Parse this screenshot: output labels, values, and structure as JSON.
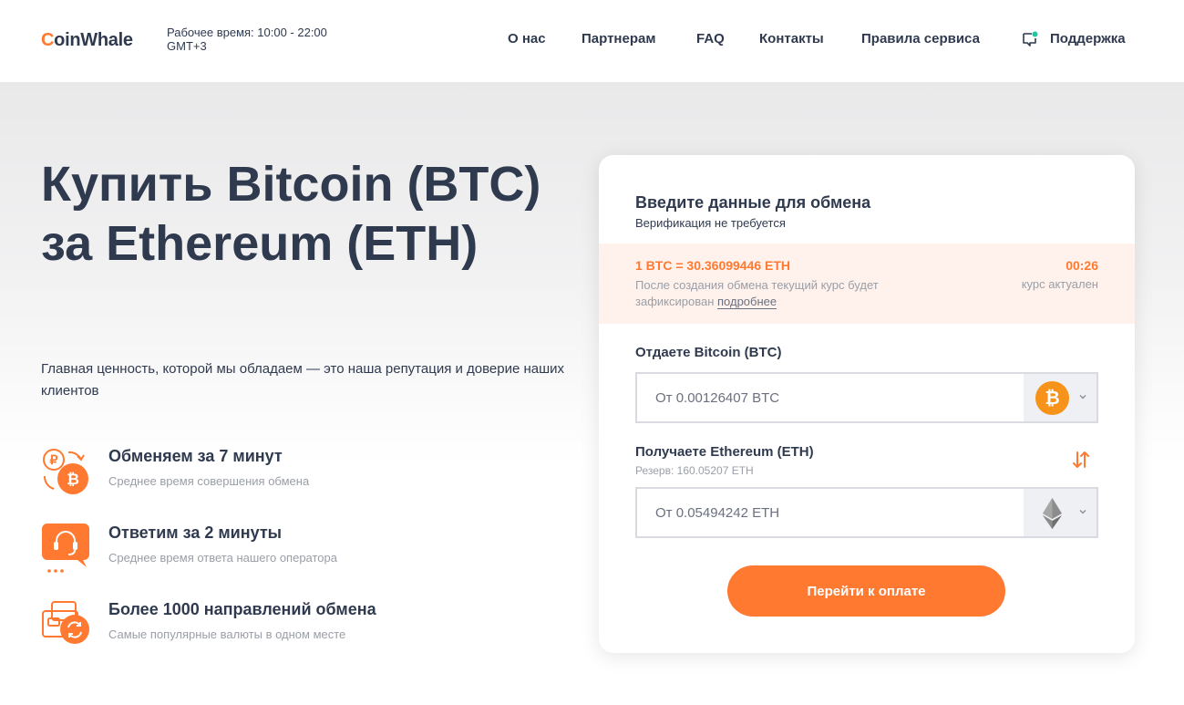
{
  "header": {
    "logo_first_letter": "C",
    "logo_rest": "oinWhale",
    "work_hours": "Рабочее время: 10:00 - 22:00 GMT+3",
    "nav": [
      {
        "label": "О нас"
      },
      {
        "label": "Партнерам"
      },
      {
        "label": "FAQ"
      },
      {
        "label": "Контакты"
      },
      {
        "label": "Правила сервиса"
      },
      {
        "label": "Поддержка",
        "icon": "chat-icon"
      }
    ]
  },
  "hero": {
    "title": "Купить Bitcoin (BTC) за Ethereum (ETH)",
    "subtitle": "Главная ценность, которой мы обладаем — это наша репутация и доверие наших клиентов",
    "features": [
      {
        "title": "Обменяем за 7 минут",
        "desc": "Среднее время совершения обмена",
        "icon": "exchange-ruble-bitcoin-icon"
      },
      {
        "title": "Ответим за 2 минуты",
        "desc": "Среднее время ответа нашего оператора",
        "icon": "headset-support-icon"
      },
      {
        "title": "Более 1000 направлений обмена",
        "desc": "Самые популярные валюты в одном месте",
        "icon": "wallets-exchange-icon"
      }
    ]
  },
  "exchange": {
    "title": "Введите данные для обмена",
    "subtitle": "Верификация не требуется",
    "rate": "1 BTC = 30.36099446 ETH",
    "rate_note": "После создания обмена текущий курс будет зафиксирован",
    "rate_link": "подробнее",
    "timer": "00:26",
    "rate_status": "курс актуален",
    "give_label": "Отдаете Bitcoin (BTC)",
    "give_placeholder": "От 0.00126407 BTC",
    "give_coin_icon": "bitcoin-icon",
    "get_label": "Получаете Ethereum (ETH)",
    "reserve": "Резерв: 160.05207 ETH",
    "get_placeholder": "От 0.05494242 ETH",
    "get_coin_icon": "ethereum-icon",
    "submit_label": "Перейти к оплате"
  },
  "colors": {
    "accent": "#ff7a30",
    "text": "#2f3a4f",
    "muted": "#9a9ea6",
    "rate_bg": "#fff2ed"
  }
}
